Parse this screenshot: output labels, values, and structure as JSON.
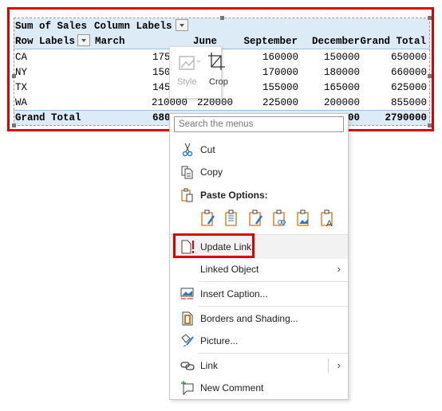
{
  "pivot": {
    "header_sum": "Sum of Sales",
    "header_col": "Column Labels",
    "header_row": "Row Labels",
    "columns": [
      "March",
      "June",
      "September",
      "December",
      "Grand Total"
    ],
    "rows": [
      {
        "label": "CA",
        "march": "175",
        "sep": "160000",
        "dec": "150000",
        "total": "650000"
      },
      {
        "label": "NY",
        "march": "150",
        "sep": "170000",
        "dec": "180000",
        "total": "660000"
      },
      {
        "label": "TX",
        "march": "145",
        "sep": "155000",
        "dec": "165000",
        "total": "625000"
      },
      {
        "label": "WA",
        "march": "210000",
        "june": "220000",
        "sep": "225000",
        "dec": "200000",
        "total": "855000"
      }
    ],
    "grand": {
      "label": "Grand Total",
      "march": "680",
      "dec": "00",
      "total": "2790000"
    }
  },
  "mini_toolbar": {
    "style": "Style",
    "crop": "Crop"
  },
  "menu": {
    "search_placeholder": "Search the menus",
    "cut": "Cut",
    "copy": "Copy",
    "paste_options": "Paste Options:",
    "update_link": "Update Link",
    "linked_object": "Linked Object",
    "insert_caption": "Insert Caption...",
    "borders": "Borders and Shading...",
    "picture": "Picture...",
    "link": "Link",
    "new_comment": "New Comment"
  },
  "colors": {
    "highlight": "#e00000",
    "pivot_band": "#ddebf7",
    "icon_blue": "#2b79c2",
    "icon_orange": "#d9730d"
  }
}
